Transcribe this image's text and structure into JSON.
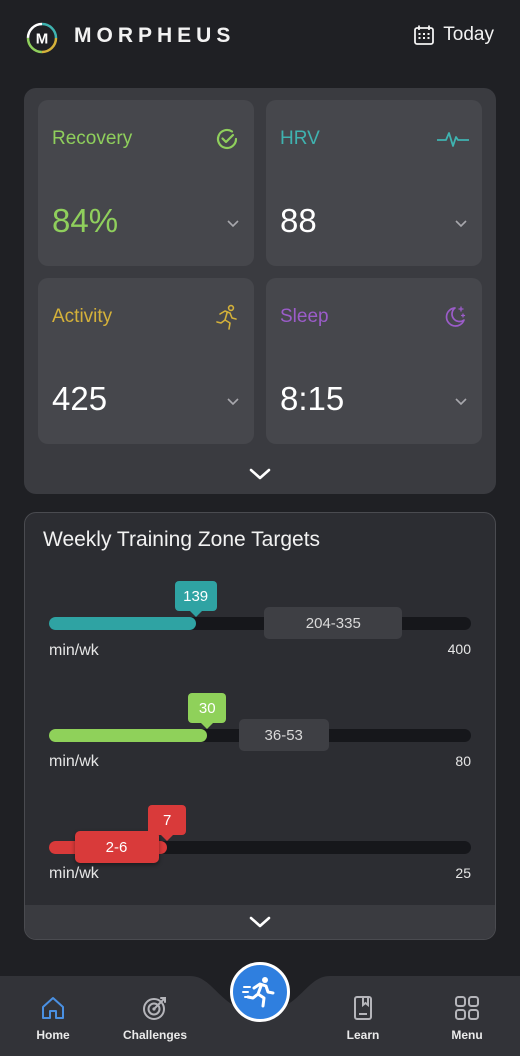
{
  "header": {
    "brand": "MORPHEUS",
    "logo_letter": "M",
    "today_label": "Today",
    "calendar_icon": "calendar-icon"
  },
  "metrics": [
    {
      "label": "Recovery",
      "value": "84%",
      "color": "#8fcf5c",
      "icon": "check-circle-icon"
    },
    {
      "label": "HRV",
      "value": "88",
      "color": "#3fb3b0",
      "icon": "heartbeat-icon"
    },
    {
      "label": "Activity",
      "value": "425",
      "color": "#d4b13a",
      "icon": "running-person-icon"
    },
    {
      "label": "Sleep",
      "value": "8:15",
      "color": "#9b5cc9",
      "icon": "moon-stars-icon"
    }
  ],
  "zones": {
    "title": "Weekly Training Zone Targets",
    "items": [
      {
        "current": "139",
        "current_value": 139,
        "target": "204-335",
        "unit": "min/wk",
        "max": "400",
        "max_value": 400,
        "color": "#2fa3a3"
      },
      {
        "current": "30",
        "current_value": 30,
        "target": "36-53",
        "unit": "min/wk",
        "max": "80",
        "max_value": 80,
        "color": "#8fd15a"
      },
      {
        "current": "7",
        "current_value": 7,
        "target": "2-6",
        "unit": "min/wk",
        "max": "25",
        "max_value": 25,
        "color": "#d93a3a"
      }
    ]
  },
  "nav": {
    "items": [
      {
        "label": "Home",
        "icon": "home-icon",
        "active": true
      },
      {
        "label": "Challenges",
        "icon": "target-icon"
      },
      {
        "label": "Learn",
        "icon": "book-icon"
      },
      {
        "label": "Menu",
        "icon": "grid-icon"
      }
    ],
    "fab_icon": "running-person-icon"
  },
  "colors": {
    "background": "#1f2024",
    "panel": "#3a3b40",
    "card": "#46474c",
    "accent_blue": "#2f7fdf"
  }
}
